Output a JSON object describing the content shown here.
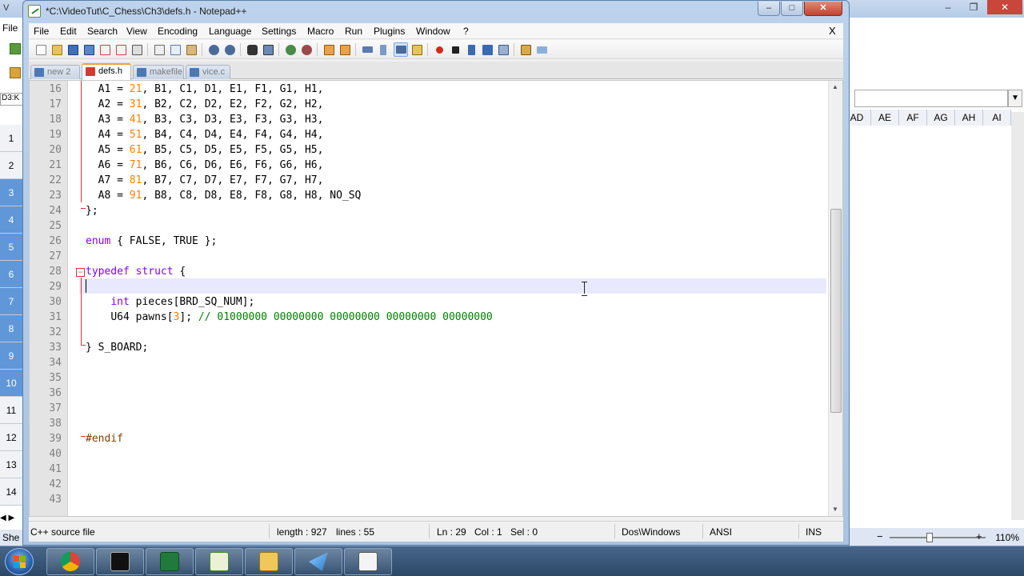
{
  "excel": {
    "title_fragment": "V",
    "menu_file": "File",
    "name_box": "D3:K",
    "row_headers": [
      "1",
      "2",
      "3",
      "4",
      "5",
      "6",
      "7",
      "8",
      "9",
      "10",
      "11",
      "12",
      "13",
      "14"
    ],
    "selected_rows": [
      "3",
      "4",
      "5",
      "6",
      "7",
      "8",
      "9",
      "10"
    ],
    "col_headers": [
      "AD",
      "AE",
      "AF",
      "AG",
      "AH",
      "AI"
    ],
    "sheet_tab_fragment": "She",
    "zoom": "110%",
    "zoom_minus": "−",
    "zoom_plus": "+"
  },
  "npp": {
    "title": "*C:\\VideoTut\\C_Chess\\Ch3\\defs.h - Notepad++",
    "menu": [
      "File",
      "Edit",
      "Search",
      "View",
      "Encoding",
      "Language",
      "Settings",
      "Macro",
      "Run",
      "Plugins",
      "Window",
      "?"
    ],
    "menu_close": "X",
    "tabs": [
      {
        "label": "new  2",
        "active": false
      },
      {
        "label": "defs.h",
        "active": true
      },
      {
        "label": "makefile",
        "active": false
      },
      {
        "label": "vice.c",
        "active": false
      }
    ],
    "line_numbers": [
      "16",
      "17",
      "18",
      "19",
      "20",
      "21",
      "22",
      "23",
      "24",
      "25",
      "26",
      "27",
      "28",
      "29",
      "30",
      "31",
      "32",
      "33",
      "34",
      "35",
      "36",
      "37",
      "38",
      "39",
      "40",
      "41",
      "42",
      "43"
    ],
    "code": {
      "l16": [
        "  A1 = ",
        "21",
        ", B1, C1, D1, E1, F1, G1, H1,"
      ],
      "l17": [
        "  A2 = ",
        "31",
        ", B2, C2, D2, E2, F2, G2, H2,"
      ],
      "l18": [
        "  A3 = ",
        "41",
        ", B3, C3, D3, E3, F3, G3, H3,"
      ],
      "l19": [
        "  A4 = ",
        "51",
        ", B4, C4, D4, E4, F4, G4, H4,"
      ],
      "l20": [
        "  A5 = ",
        "61",
        ", B5, C5, D5, E5, F5, G5, H5,"
      ],
      "l21": [
        "  A6 = ",
        "71",
        ", B6, C6, D6, E6, F6, G6, H6,"
      ],
      "l22": [
        "  A7 = ",
        "81",
        ", B7, C7, D7, E7, F7, G7, H7,"
      ],
      "l23": [
        "  A8 = ",
        "91",
        ", B8, C8, D8, E8, F8, G8, H8, NO_SQ"
      ],
      "l24": "};",
      "l26_kw": "enum",
      "l26_rest": " { FALSE, TRUE };",
      "l28_kw1": "typedef",
      "l28_kw2": "struct",
      "l28_rest": " {",
      "l30_kw": "int",
      "l30_rest": " pieces[BRD_SQ_NUM];",
      "l31_a": "U64 pawns[",
      "l31_num": "3",
      "l31_b": "]; ",
      "l31_cmt": "// 01000000 00000000 00000000 00000000 00000000",
      "l33": "} S_BOARD;",
      "l39": "#endif"
    },
    "status": {
      "file_type": "C++ source file",
      "length": "length : 927",
      "lines": "lines : 55",
      "ln": "Ln : 29",
      "col": "Col : 1",
      "sel": "Sel : 0",
      "eol": "Dos\\Windows",
      "encoding": "ANSI",
      "mode": "INS"
    },
    "caption_buttons": {
      "minimize": "–",
      "maximize": "□",
      "close": "✕"
    }
  },
  "excel_caption_buttons": {
    "minimize": "–",
    "restore": "❐",
    "close": "✕"
  },
  "taskbar": {
    "apps": [
      "chrome-icon",
      "cmd-icon",
      "excel-icon",
      "notepadpp-icon",
      "explorer-icon",
      "vpn-icon",
      "calculator-icon"
    ]
  },
  "colors": {
    "keyword": "#8000ff",
    "number": "#ff8000",
    "comment": "#008000",
    "preprocessor": "#804000",
    "current_line": "#e8e8ff"
  }
}
